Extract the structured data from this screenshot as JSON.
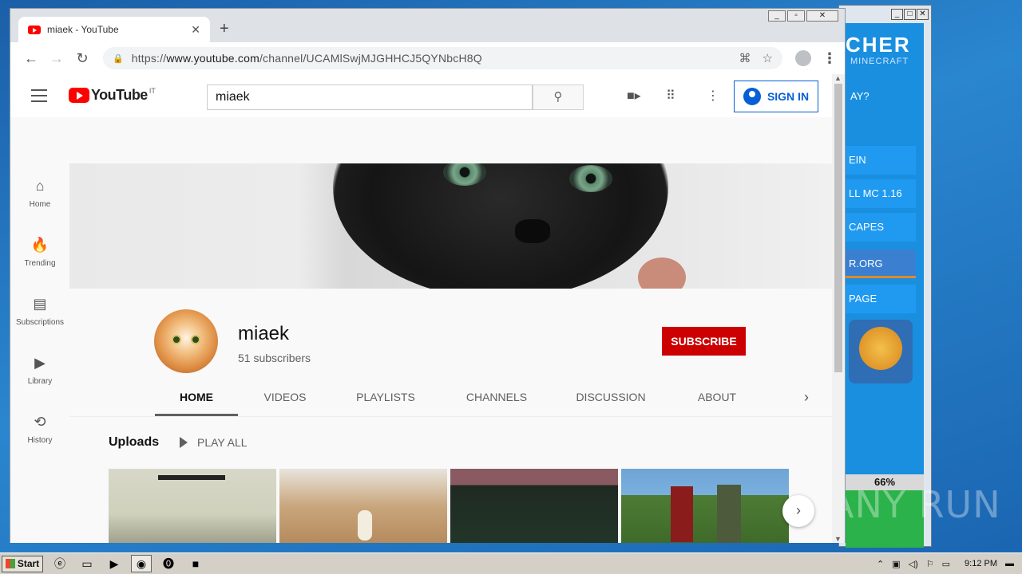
{
  "browser": {
    "tab_title": "miaek - YouTube",
    "url_prefix": "https://",
    "url_host": "www.youtube.com",
    "url_path": "/channel/UCAMlSwjMJGHHCJ5QYNbcH8Q",
    "new_tab_label": "+",
    "close_tab_label": "✕",
    "back_label": "←",
    "forward_label": "→",
    "reload_label": "↻",
    "star_label": "☆",
    "menu_label": "⋮"
  },
  "youtube": {
    "logo_text": "YouTube",
    "country_code": "IT",
    "search_value": "miaek",
    "sign_in_label": "SIGN IN",
    "sidebar": [
      {
        "label": "Home",
        "icon": "⌂"
      },
      {
        "label": "Trending",
        "icon": "🔥"
      },
      {
        "label": "Subscriptions",
        "icon": "▤"
      },
      {
        "label": "Library",
        "icon": "▶"
      },
      {
        "label": "History",
        "icon": "⟲"
      }
    ],
    "channel": {
      "name": "miaek",
      "subscribers": "51 subscribers",
      "subscribe_label": "SUBSCRIBE"
    },
    "tabs": [
      "HOME",
      "VIDEOS",
      "PLAYLISTS",
      "CHANNELS",
      "DISCUSSION",
      "ABOUT"
    ],
    "uploads_title": "Uploads",
    "play_all_label": "PLAY ALL"
  },
  "launcher": {
    "brand": "CHER",
    "subtitle": "MINECRAFT",
    "question": "AY?",
    "buttons": [
      "EIN",
      "LL MC 1.16",
      "CAPES",
      "R.ORG",
      "PAGE"
    ],
    "progress": "66%"
  },
  "watermark": "ANY RUN",
  "taskbar": {
    "start_label": "Start",
    "clock": "9:12 PM"
  },
  "colors": {
    "youtube_red": "#ff0000",
    "subscribe_red": "#cc0000",
    "sign_in_blue": "#065fd4",
    "launcher_blue": "#1a8fe0"
  }
}
